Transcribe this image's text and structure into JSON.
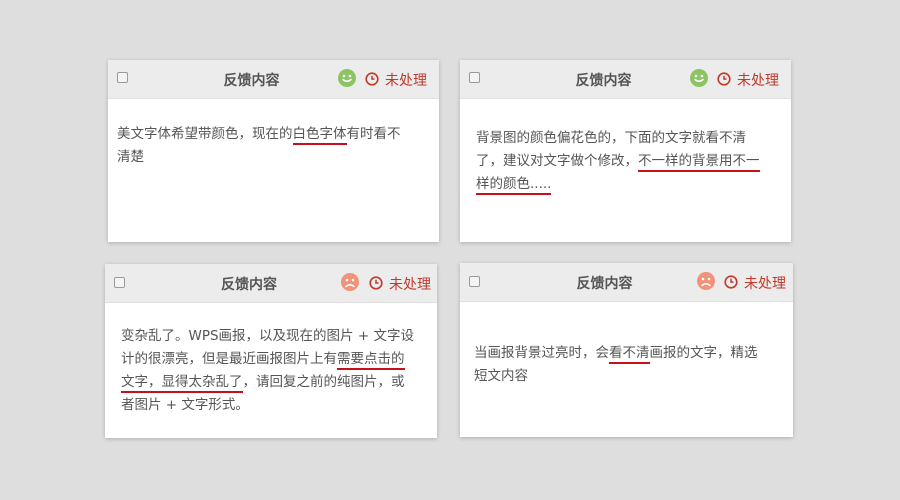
{
  "cards": [
    {
      "title": "反馈内容",
      "status": "未处理",
      "face": "happy-face-icon",
      "body": {
        "line1_pre": "美文字体希望带颜色，现在的",
        "line1_u": "白色字体",
        "line1_post": "有时看不",
        "line2": "清楚"
      }
    },
    {
      "title": "反馈内容",
      "status": "未处理",
      "face": "happy-face-icon",
      "body": {
        "line1": "背景图的颜色偏花色的，下面的文字就看不清",
        "line2_pre": "了，建议对文字做个修改，",
        "line2_u": "不一样的背景用不一",
        "line3_u": "样的颜色....."
      }
    },
    {
      "title": "反馈内容",
      "status": "未处理",
      "face": "sad-face-icon",
      "body": {
        "line1": "变杂乱了。WPS画报，以及现在的图片 + 文字设",
        "line2_pre": "计的很漂亮，但是最近画报图片上有",
        "line2_u": "需要点击的",
        "line3_u": "文字，显得太杂乱了",
        "line3_post": "，请回复之前的纯图片，或",
        "line4": "者图片 + 文字形式。"
      }
    },
    {
      "title": "反馈内容",
      "status": "未处理",
      "face": "sad-face-icon",
      "body": {
        "line1_pre": "当画报背景过亮时，会",
        "line1_u": "看不清",
        "line1_post": "画报的文字，精选",
        "line2": "短文内容"
      }
    }
  ],
  "colors": {
    "happy": "#8dc463",
    "sad": "#f0937a",
    "status": "#c0392b",
    "underline": "#c8101a"
  }
}
